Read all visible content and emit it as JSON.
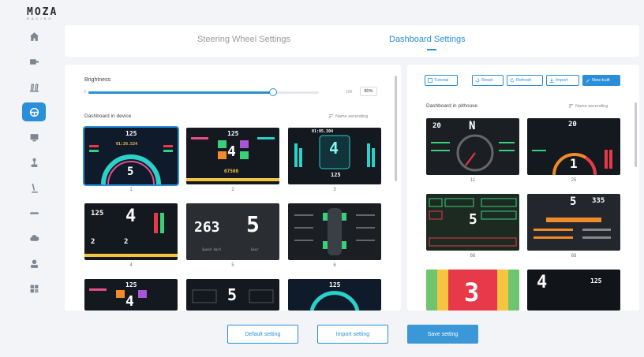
{
  "logo": {
    "main": "MOZA",
    "sub": "RACING"
  },
  "sidebar": {
    "items": [
      {
        "icon": "home-icon",
        "active": false
      },
      {
        "icon": "wheelbase-icon",
        "active": false
      },
      {
        "icon": "pedals-icon",
        "active": false
      },
      {
        "icon": "steering-wheel-icon",
        "active": true
      },
      {
        "icon": "dashboard-icon",
        "active": false
      },
      {
        "icon": "shifter-icon",
        "active": false
      },
      {
        "icon": "handbrake-icon",
        "active": false
      },
      {
        "icon": "hub-icon",
        "active": false
      },
      {
        "icon": "cloud-icon",
        "active": false
      },
      {
        "icon": "user-icon",
        "active": false
      },
      {
        "icon": "settings-icon",
        "active": false
      }
    ]
  },
  "tabs": {
    "steering": "Steering Wheel Settings",
    "dashboard": "Dashboard Settings",
    "active": "dashboard"
  },
  "brightness": {
    "label": "Brightness",
    "level": 0.8,
    "min_label": "0",
    "max_label": "100",
    "value": "80%"
  },
  "device": {
    "title": "Dashboard in device",
    "sort": "Name ascending",
    "items": [
      {
        "number": "1",
        "selected": true
      },
      {
        "number": "2",
        "selected": false
      },
      {
        "number": "3",
        "selected": false
      },
      {
        "number": "4",
        "selected": false
      },
      {
        "number": "5",
        "selected": false
      },
      {
        "number": "6",
        "selected": false
      },
      {
        "number": "",
        "selected": false
      },
      {
        "number": "",
        "selected": false
      },
      {
        "number": "",
        "selected": false
      }
    ],
    "thumb_texts": {
      "t1_speed": "125",
      "t1_gear": "5",
      "t1_time": "01:26.524",
      "t2_speed": "125",
      "t2_gear": "4",
      "t2_rpm": "07500",
      "t3_gear": "4",
      "t3_speed": "125",
      "t3_time": "01:05.304",
      "t4_speed": "125",
      "t4_gear": "4",
      "t4_small1": "2",
      "t4_small2": "2",
      "t5_speed": "263",
      "t5_gear": "5",
      "t5_speed_label": "Speed km/h",
      "t5_gear_label": "Gear",
      "t7_speed": "125",
      "t7_gear": "4",
      "t8_gear": "5",
      "t9_speed": "125"
    }
  },
  "pithouse": {
    "title": "Dashboard in pithouse",
    "sort": "Name ascending",
    "toolbar": {
      "tutorial": "Tutorial",
      "reset": "Reset",
      "refresh": "Refresh",
      "import": "Import",
      "new_built": "New built"
    },
    "items": [
      {
        "number": "11"
      },
      {
        "number": "25"
      },
      {
        "number": "66"
      },
      {
        "number": "68"
      },
      {
        "number": ""
      },
      {
        "number": ""
      }
    ],
    "thumb_texts": {
      "p1_gear": "N",
      "p1_speed": "20",
      "p2_speed": "20",
      "p2_gear": "1",
      "p3_gear": "5",
      "p4_gear": "5",
      "p4_speed": "335",
      "p5_gear": "3",
      "p6_gear": "4",
      "p6_speed": "125"
    }
  },
  "bottom": {
    "default": "Default setting",
    "import": "Import setting",
    "save": "Save setting"
  },
  "colors": {
    "accent": "#2a8fd8",
    "dash_bg": "#14181f"
  }
}
